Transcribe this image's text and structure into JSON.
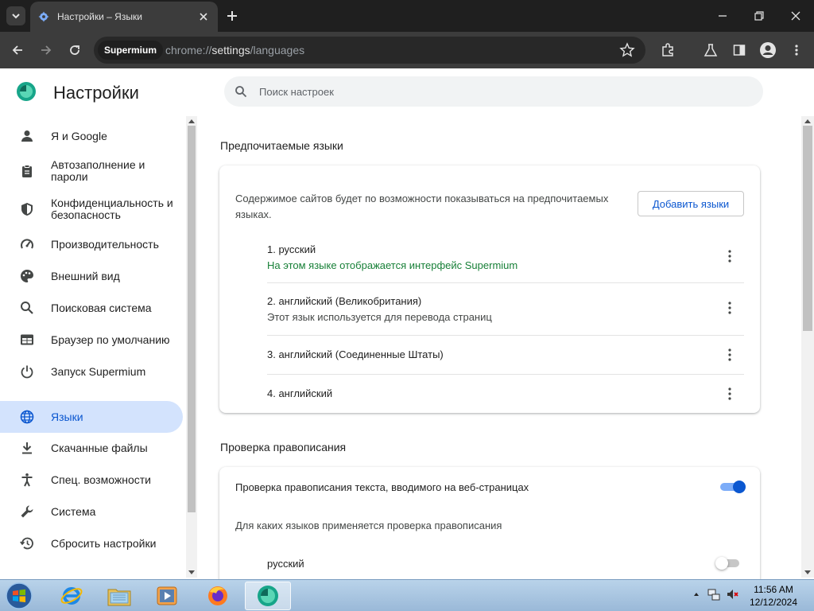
{
  "tab": {
    "title": "Настройки – Языки",
    "favicon": "gear-icon"
  },
  "omnibox": {
    "chip": "Supermium",
    "url_prefix": "chrome://",
    "url_host": "settings",
    "url_path": "/languages"
  },
  "colors": {
    "accent": "#0b57d0",
    "active_nav_bg": "#d3e3fd",
    "green_text": "#188038",
    "chrome_dark": "#1f1f1f",
    "toolbar": "#3c3c3c"
  },
  "settings": {
    "title": "Настройки",
    "search_placeholder": "Поиск настроек"
  },
  "sidebar": {
    "items": [
      {
        "label": "Я и Google",
        "icon": "person-icon"
      },
      {
        "label": "Автозаполнение и пароли",
        "icon": "clipboard-icon"
      },
      {
        "label": "Конфиденциальность и безопасность",
        "icon": "shield-icon"
      },
      {
        "label": "Производительность",
        "icon": "speedometer-icon"
      },
      {
        "label": "Внешний вид",
        "icon": "palette-icon"
      },
      {
        "label": "Поисковая система",
        "icon": "search-icon"
      },
      {
        "label": "Браузер по умолчанию",
        "icon": "browser-icon"
      },
      {
        "label": "Запуск Supermium",
        "icon": "power-icon"
      },
      {
        "label": "Языки",
        "icon": "globe-icon",
        "active": true
      },
      {
        "label": "Скачанные файлы",
        "icon": "download-icon"
      },
      {
        "label": "Спец. возможности",
        "icon": "accessibility-icon"
      },
      {
        "label": "Система",
        "icon": "wrench-icon"
      },
      {
        "label": "Сбросить настройки",
        "icon": "history-icon"
      }
    ]
  },
  "preferred": {
    "title": "Предпочитаемые языки",
    "description": "Содержимое сайтов будет по возможности показываться на предпочитаемых языках.",
    "add_button": "Добавить языки",
    "languages": [
      {
        "name": "1. русский",
        "note": "На этом языке отображается интерфейс Supermium"
      },
      {
        "name": "2. английский (Великобритания)",
        "note": "Этот язык используется для перевода страниц"
      },
      {
        "name": "3. английский (Соединенные Штаты)",
        "note": ""
      },
      {
        "name": "4. английский",
        "note": ""
      }
    ]
  },
  "spellcheck": {
    "title": "Проверка правописания",
    "toggle_label": "Проверка правописания текста, вводимого на веб-страницах",
    "toggle_on": true,
    "langs_label": "Для каких языков применяется проверка правописания",
    "lang_russian": "русский",
    "lang_russian_on": false
  },
  "taskbar": {
    "apps": [
      "internet-explorer-icon",
      "file-explorer-icon",
      "media-player-icon",
      "firefox-icon",
      "supermium-icon"
    ],
    "time": "11:56 AM",
    "date": "12/12/2024"
  }
}
